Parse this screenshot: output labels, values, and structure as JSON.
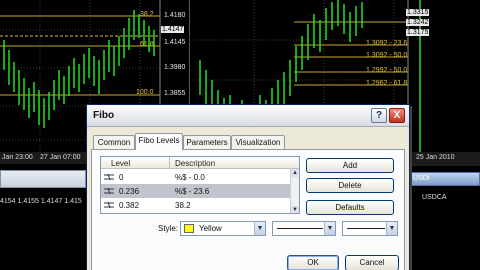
{
  "left_chart": {
    "fibo_labels": [
      "38.2",
      "61.8",
      "100.0"
    ],
    "price_axis": [
      "1.4180",
      "1.4145",
      "1.3980",
      "1.3855"
    ],
    "price_highlight": "1.4147",
    "time_labels": [
      "Jan 23:00",
      "27 Jan 07:00"
    ]
  },
  "right_chart": {
    "fibo_labels": [
      "1.3092 - 23.6",
      "1.3092 - 50.0",
      "1.2992 - 50.0",
      "1.2962 - 61.8"
    ],
    "price_axis": [
      "1.3315",
      "1.3175"
    ],
    "price_highlight": "1.3242",
    "time_label": "25 Jan 2010"
  },
  "bottom_left_window": {
    "row_text": "4154 1.4155 1.4147 1.415"
  },
  "bottom_right_window": {
    "title": "USDi",
    "symbol": "USDCA"
  },
  "dialog": {
    "title": "Fibo",
    "help_label": "?",
    "close_label": "X",
    "tabs": [
      "Common",
      "Fibo Levels",
      "Parameters",
      "Visualization"
    ],
    "active_tab": "Fibo Levels",
    "levels_table": {
      "columns": [
        "Level",
        "Description"
      ],
      "rows": [
        {
          "level": "0",
          "description": "%$ - 0.0"
        },
        {
          "level": "0.236",
          "description": "%$ - 23.6"
        },
        {
          "level": "0.382",
          "description": "38.2"
        }
      ],
      "selected_row": 1
    },
    "buttons": {
      "add": "Add",
      "delete": "Delete",
      "defaults": "Defaults",
      "ok": "OK",
      "cancel": "Cancel"
    },
    "style": {
      "label": "Style:",
      "color_name": "Yellow",
      "color_hex": "#ffff00"
    }
  }
}
